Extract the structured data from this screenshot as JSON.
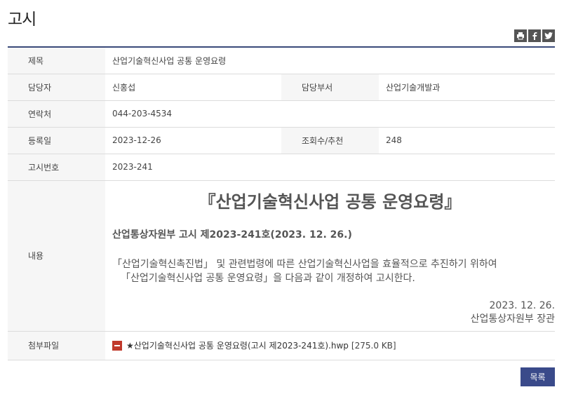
{
  "page": {
    "title": "고시"
  },
  "share": {
    "icons": [
      "print-icon",
      "facebook-icon",
      "twitter-icon"
    ]
  },
  "info": {
    "subject_label": "제목",
    "subject_value": "산업기술혁신사업 공통 운영요령",
    "manager_label": "담당자",
    "manager_value": "신홍섭",
    "dept_label": "담당부서",
    "dept_value": "산업기술개발과",
    "contact_label": "연락처",
    "contact_value": "044-203-4534",
    "date_label": "등록일",
    "date_value": "2023-12-26",
    "views_label": "조회수/추천",
    "views_value": "248",
    "notice_no_label": "고시번호",
    "notice_no_value": "2023-241",
    "content_label": "내용",
    "attach_label": "첨부파일"
  },
  "content": {
    "title": "『산업기술혁신사업 공통 운영요령』",
    "subtitle": "산업통상자원부 고시 제2023-241호(2023. 12. 26.)",
    "line1": "「산업기술혁신촉진법」 및 관련법령에 따른 산업기술혁신사업을 효율적으로 추진하기 위하여",
    "line2": "「산업기술혁신사업 공통 운영요령」을 다음과 같이 개정하여 고시한다.",
    "date": "2023. 12. 26.",
    "signature": "산업통상자원부 장관"
  },
  "attachment": {
    "filename": "★산업기술혁신사업 공통 운영요령(고시 제2023-241호).hwp",
    "size": "[275.0 KB]"
  },
  "buttons": {
    "list_label": "목록"
  },
  "colors": {
    "accent": "#3a4a8a",
    "label_bg": "#f6f6f6",
    "file_icon": "#c0392b"
  }
}
